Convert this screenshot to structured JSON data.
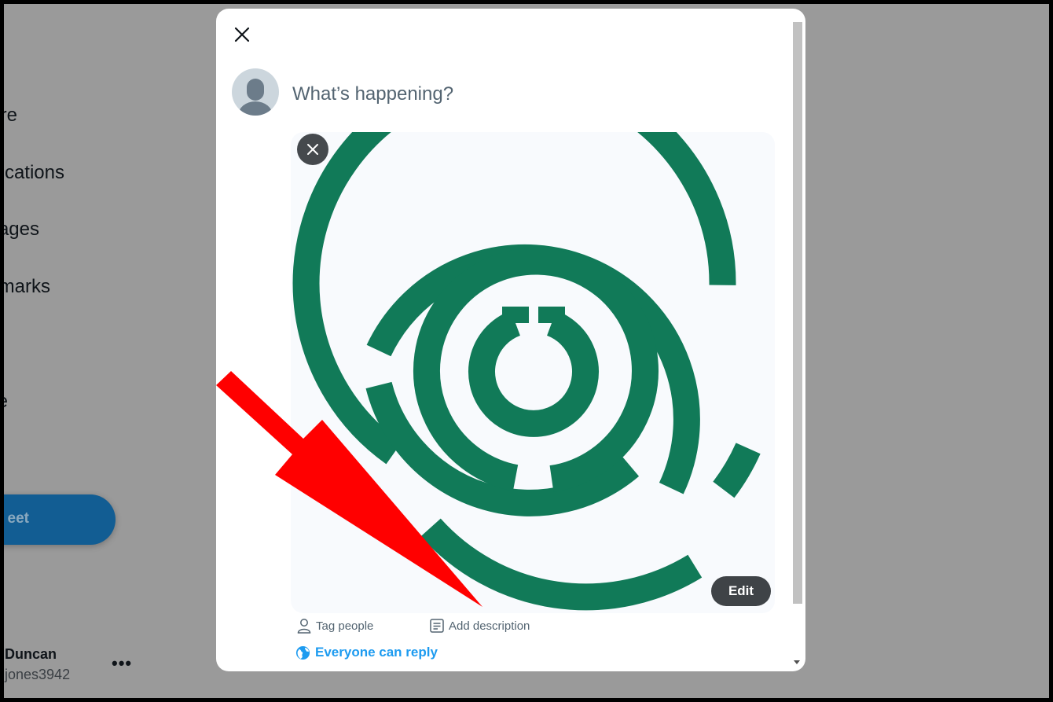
{
  "sidebar": {
    "items": [
      {
        "label": "Explore",
        "visible_text": "re"
      },
      {
        "label": "Notifications",
        "visible_text": "cations"
      },
      {
        "label": "Messages",
        "visible_text": "ages"
      },
      {
        "label": "Bookmarks",
        "visible_text": "marks"
      },
      {
        "label": "Profile",
        "visible_text": "e"
      }
    ],
    "tweet_button_visible_text": "eet",
    "user": {
      "name_visible_text": "Duncan",
      "handle_visible_text": "jones3942",
      "more_label": "•••"
    }
  },
  "compose": {
    "placeholder": "What’s happening?",
    "edit_label": "Edit",
    "tag_people_label": "Tag people",
    "add_description_label": "Add description",
    "reply_setting_label": "Everyone can reply"
  },
  "icons": {
    "close": "close-icon",
    "remove_media": "close-icon",
    "tag_people": "person-icon",
    "add_description": "description-icon",
    "reply_setting": "globe-icon",
    "annotation": "red-arrow"
  },
  "colors": {
    "overlay_gray": "#9a9a9a",
    "maze_green": "#117a58",
    "accent_blue": "#1d9bf0",
    "annotation_red": "#ff0000",
    "tweet_button": "#125d93"
  }
}
